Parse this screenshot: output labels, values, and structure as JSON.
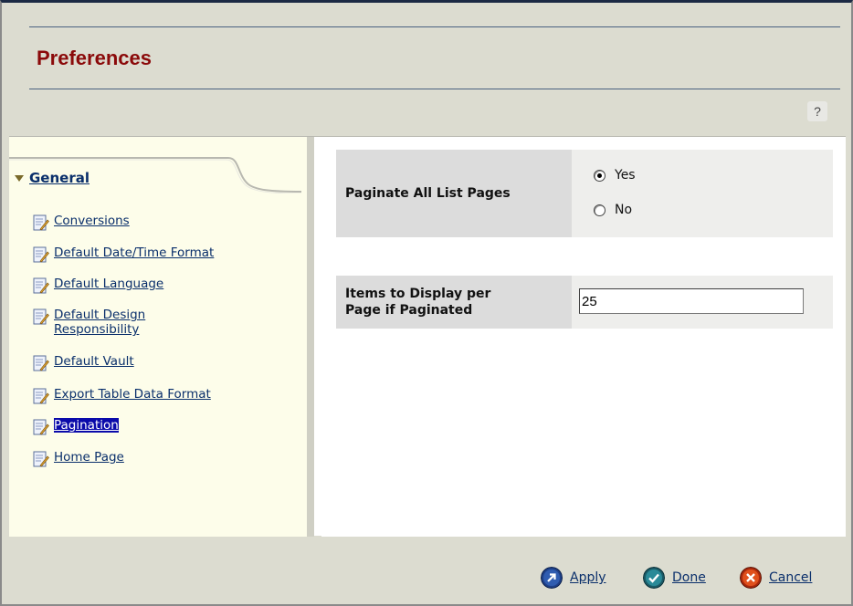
{
  "window": {
    "title": "Preferences",
    "help_label": "?"
  },
  "sidebar": {
    "section": "General",
    "items": [
      {
        "label": "Conversions"
      },
      {
        "label": "Default Date/Time Format"
      },
      {
        "label": "Default Language"
      },
      {
        "label": "Default Design",
        "label2": "Responsibility"
      },
      {
        "label": "Default Vault"
      },
      {
        "label": "Export Table Data Format"
      },
      {
        "label": "Pagination",
        "selected": true
      },
      {
        "label": "Home Page"
      }
    ]
  },
  "form": {
    "paginate": {
      "label": "Paginate All List Pages",
      "options": [
        "Yes",
        "No"
      ],
      "selected": "Yes"
    },
    "items_per_page": {
      "label_line1": "Items to Display per",
      "label_line2": "Page if Paginated",
      "value": "25"
    }
  },
  "footer": {
    "apply": "Apply",
    "done": "Done",
    "cancel": "Cancel"
  },
  "colors": {
    "title": "#8b0a0a",
    "link": "#0a2f6b",
    "selected_bg": "#0a0aaa",
    "sidebar_bg": "#fdfdea",
    "chrome_bg": "#dcdcd0"
  }
}
